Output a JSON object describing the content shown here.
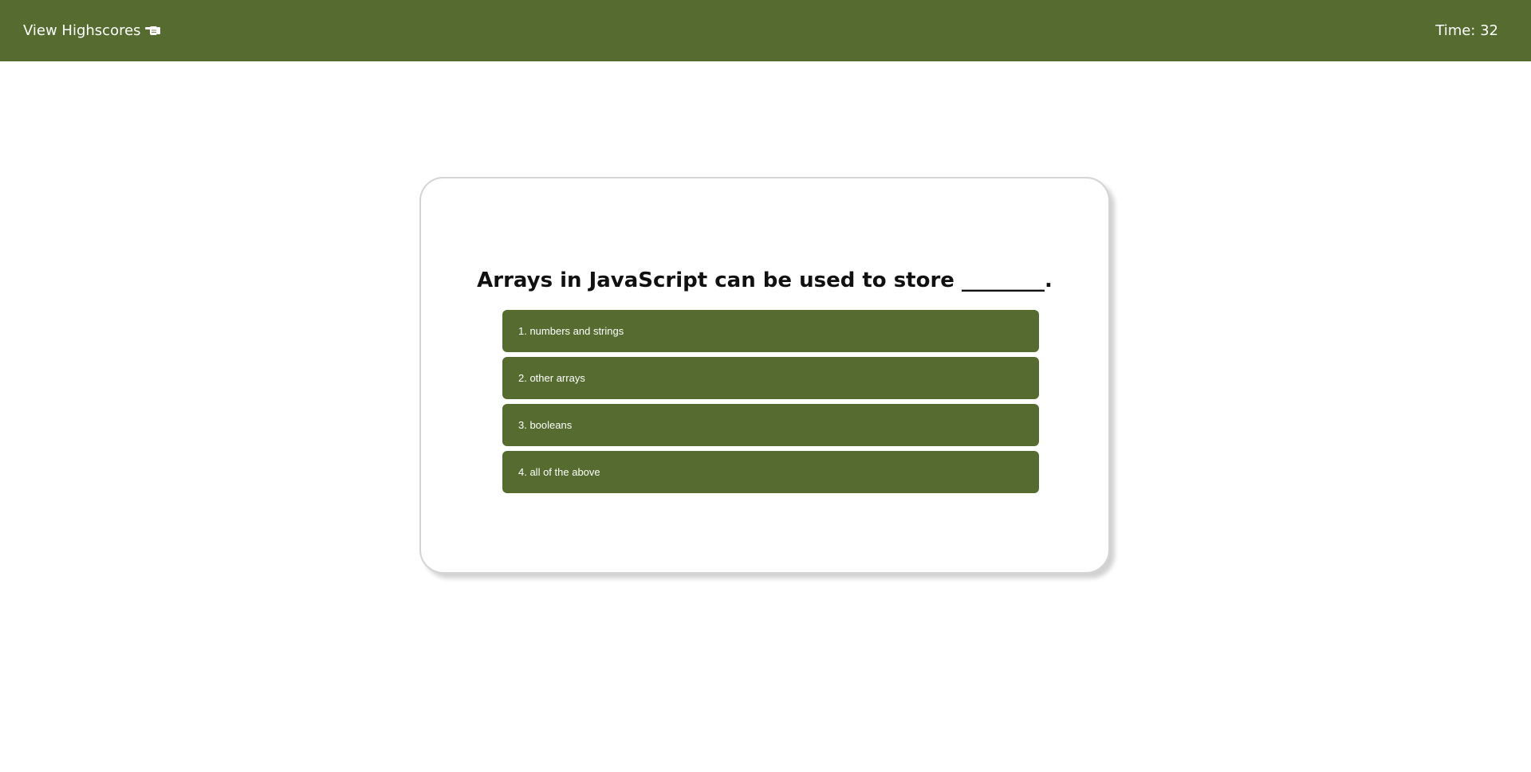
{
  "header": {
    "highscores_label": "View Highscores",
    "hand_icon": "pointing-hand-icon",
    "timer_text": "Time: 32"
  },
  "quiz": {
    "question": "Arrays in JavaScript can be used to store ________.",
    "answers": [
      "1. numbers and strings",
      "2. other arrays",
      "3. booleans",
      "4. all of the above"
    ]
  },
  "colors": {
    "accent": "#556b2f",
    "background": "#ffffff",
    "card_border": "#d4d4d4"
  }
}
